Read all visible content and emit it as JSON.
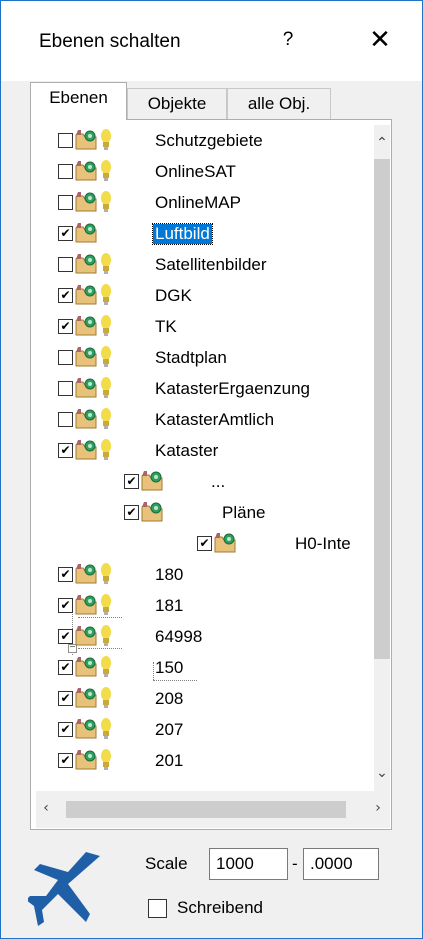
{
  "window": {
    "title": "Ebenen schalten",
    "help": "?",
    "close": "✕"
  },
  "tabs": [
    "Ebenen",
    "Objekte",
    "alle Obj."
  ],
  "tree": {
    "rows": [
      {
        "label": "Schutzgebiete",
        "checked": false,
        "bulb": true,
        "level": 0
      },
      {
        "label": "OnlineSAT",
        "checked": false,
        "bulb": true,
        "level": 0
      },
      {
        "label": "OnlineMAP",
        "checked": false,
        "bulb": true,
        "level": 0
      },
      {
        "label": "Luftbild",
        "checked": true,
        "bulb": false,
        "level": 0,
        "selected": true
      },
      {
        "label": "Satellitenbilder",
        "checked": false,
        "bulb": true,
        "level": 0
      },
      {
        "label": "DGK",
        "checked": true,
        "bulb": true,
        "level": 0
      },
      {
        "label": "TK",
        "checked": true,
        "bulb": true,
        "level": 0
      },
      {
        "label": "Stadtplan",
        "checked": false,
        "bulb": true,
        "level": 0
      },
      {
        "label": "KatasterErgaenzung",
        "checked": false,
        "bulb": true,
        "level": 0
      },
      {
        "label": "KatasterAmtlich",
        "checked": false,
        "bulb": true,
        "level": 0
      },
      {
        "label": "Kataster",
        "checked": true,
        "bulb": true,
        "level": 0
      },
      {
        "label": "...",
        "checked": true,
        "bulb": false,
        "level": 1
      },
      {
        "label": "Pläne",
        "checked": true,
        "bulb": false,
        "level": 1,
        "expander": true
      },
      {
        "label": "H0-Inte",
        "checked": true,
        "bulb": false,
        "level": 2
      },
      {
        "label": "180",
        "checked": true,
        "bulb": true,
        "level": 0
      },
      {
        "label": "181",
        "checked": true,
        "bulb": true,
        "level": 0
      },
      {
        "label": "64998",
        "checked": true,
        "bulb": true,
        "level": 0
      },
      {
        "label": "150",
        "checked": true,
        "bulb": true,
        "level": 0
      },
      {
        "label": "208",
        "checked": true,
        "bulb": true,
        "level": 0
      },
      {
        "label": "207",
        "checked": true,
        "bulb": true,
        "level": 0
      },
      {
        "label": "201",
        "checked": true,
        "bulb": true,
        "level": 0
      }
    ]
  },
  "scale": {
    "label": "Scale",
    "from_value": "1000",
    "separator": "-",
    "to_value": ".0000"
  },
  "writing": {
    "label": "Schreibend",
    "checked": false
  },
  "colors": {
    "accent": "#0078d7",
    "plane": "#1f5fa8",
    "folder": "#e8c27a",
    "bulb": "#f2dc4a"
  }
}
